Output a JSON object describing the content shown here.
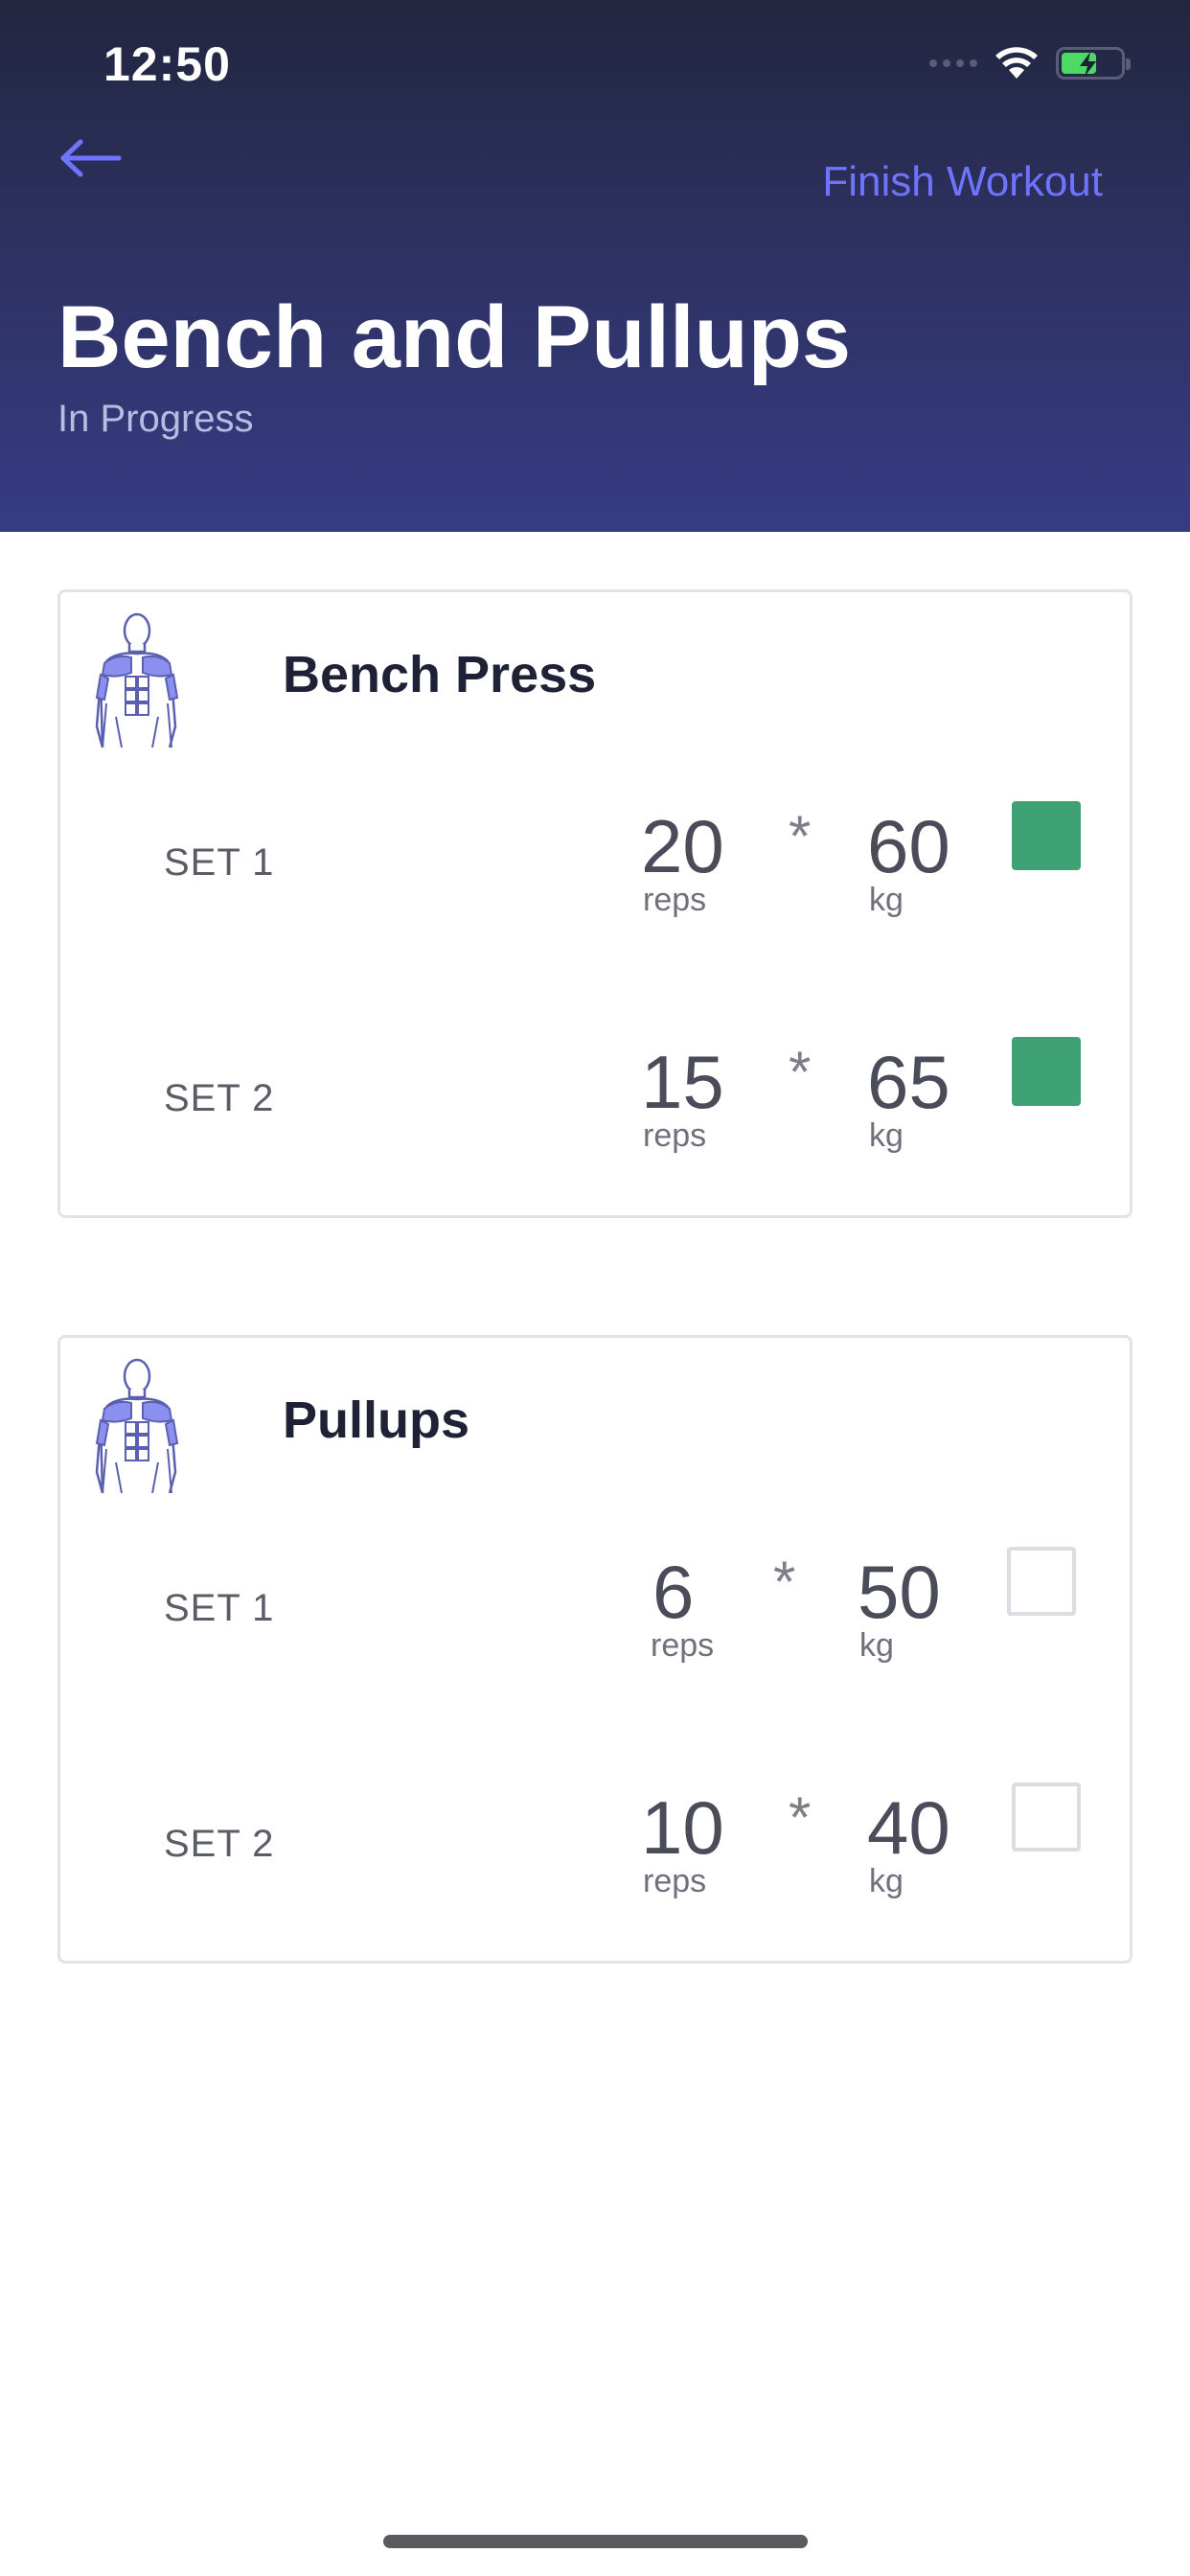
{
  "status_bar": {
    "time": "12:50"
  },
  "header": {
    "finish_label": "Finish Workout",
    "title": "Bench and Pullups",
    "subtitle": "In Progress"
  },
  "colors": {
    "accent": "#6f74ff",
    "complete": "#3fa274",
    "header_top": "#22263f",
    "header_bottom": "#363c84"
  },
  "exercises": [
    {
      "name": "Bench Press",
      "icon": "upper-body-muscle-icon",
      "sets": [
        {
          "label": "SET 1",
          "reps": "20",
          "reps_unit": "reps",
          "sep": "*",
          "weight": "60",
          "weight_unit": "kg",
          "completed": true
        },
        {
          "label": "SET 2",
          "reps": "15",
          "reps_unit": "reps",
          "sep": "*",
          "weight": "65",
          "weight_unit": "kg",
          "completed": true
        }
      ]
    },
    {
      "name": "Pullups",
      "icon": "upper-body-muscle-icon",
      "sets": [
        {
          "label": "SET 1",
          "reps": "6",
          "reps_unit": "reps",
          "sep": "*",
          "weight": "50",
          "weight_unit": "kg",
          "completed": false
        },
        {
          "label": "SET 2",
          "reps": "10",
          "reps_unit": "reps",
          "sep": "*",
          "weight": "40",
          "weight_unit": "kg",
          "completed": false
        }
      ]
    }
  ]
}
